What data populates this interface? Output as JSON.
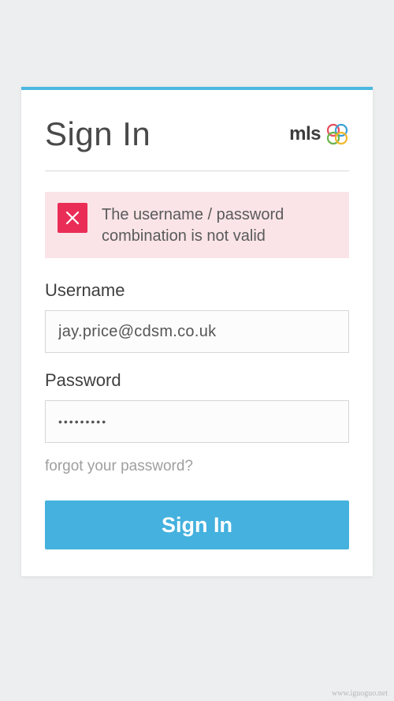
{
  "card": {
    "title": "Sign In",
    "logo_text": "mls"
  },
  "alert": {
    "message": "The username / password combination is not valid"
  },
  "fields": {
    "username": {
      "label": "Username",
      "value": "jay.price@cdsm.co.uk"
    },
    "password": {
      "label": "Password",
      "value": "*********"
    }
  },
  "links": {
    "forgot": "forgot your password?"
  },
  "buttons": {
    "submit": "Sign In"
  },
  "watermark": "www.iguoguo.net",
  "colors": {
    "accent": "#44b1de",
    "error": "#ea2d56",
    "error_bg": "#fae4e8"
  }
}
